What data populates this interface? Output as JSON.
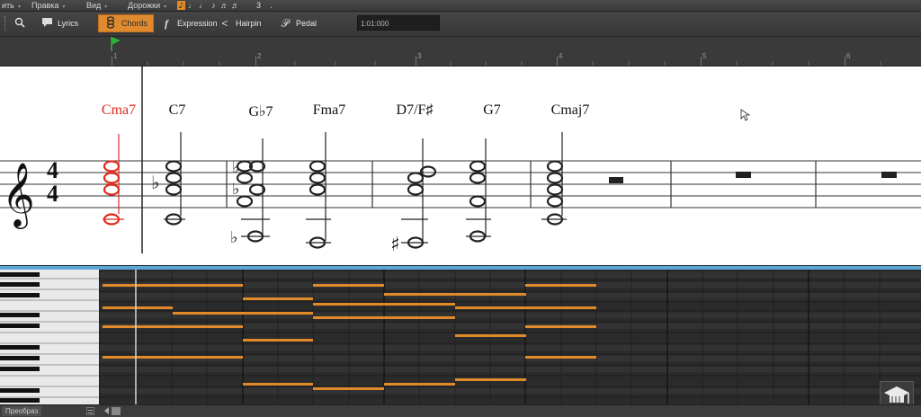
{
  "menubar": {
    "items": [
      {
        "label": "ить",
        "arrow": "▾"
      },
      {
        "label": "Правка",
        "arrow": "▾"
      },
      {
        "label": "Вид",
        "arrow": "▾"
      },
      {
        "label": "Дорожки",
        "arrow": "▾"
      }
    ],
    "durations": [
      "𝅘𝅥𝅮",
      "♩",
      "♩",
      "♪",
      "♬",
      "♬",
      "3",
      "."
    ]
  },
  "toolbar": {
    "lyrics_label": "Lyrics",
    "chords_label": "Chords",
    "expression_label": "Expression",
    "expression_glyph": "f",
    "hairpin_label": "Hairpin",
    "hairpin_glyph": "<",
    "pedal_label": "Pedal",
    "pedal_glyph": "𝒫",
    "position_value": "1:01:000"
  },
  "ruler": {
    "marks": [
      "1",
      "2",
      "3",
      "4",
      "5",
      "6"
    ]
  },
  "score": {
    "time_signature": {
      "top": "4",
      "bottom": "4"
    },
    "clef": "𝄞",
    "chords": [
      {
        "symbol": "Cma7",
        "selected": true
      },
      {
        "symbol": "C7",
        "selected": false
      },
      {
        "symbol": "G♭7",
        "selected": false
      },
      {
        "symbol": "Fma7",
        "selected": false
      },
      {
        "symbol": "D7/F♯",
        "selected": false
      },
      {
        "symbol": "G7",
        "selected": false
      },
      {
        "symbol": "Cmaj7",
        "selected": false
      }
    ]
  },
  "statusbar": {
    "tab_label": "Преобраз"
  },
  "colors": {
    "accent": "#e08a2f",
    "selection": "#e3291f",
    "note_bar": "#e08a2a",
    "divider": "#5ba7d6"
  },
  "icons": {
    "zoom": "magnifier-icon",
    "lyrics": "speech-bubble-icon",
    "chords": "chord-stack-icon",
    "course": "graduation-cap-icon"
  }
}
